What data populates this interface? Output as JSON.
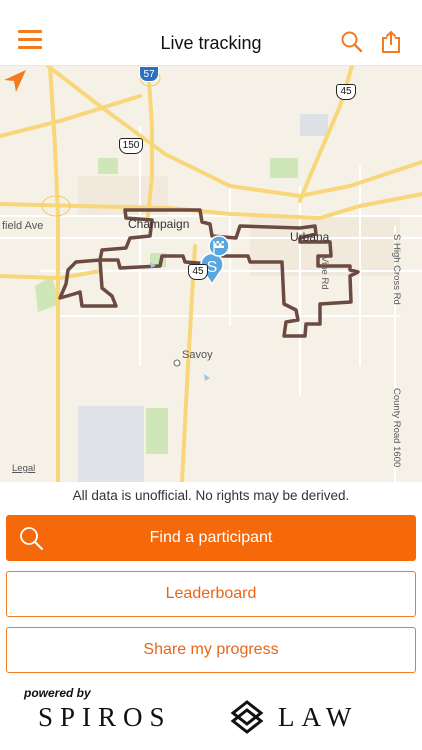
{
  "header": {
    "title": "Live tracking",
    "menu_icon": "hamburger-menu-icon",
    "search_icon": "search-icon",
    "share_icon": "share-icon"
  },
  "map": {
    "cities": {
      "champaign": "Champaign",
      "urbana": "Urbana",
      "savoy": "Savoy"
    },
    "roads": {
      "left_ave": "field Ave",
      "high_cross": "S High Cross Rd",
      "county_road": "County Road 1600",
      "vine": "Vine Rd"
    },
    "shields": {
      "i57": "57",
      "us150": "150",
      "us45_top": "45",
      "us45_mid": "45"
    },
    "legal": "Legal",
    "route_color": "#6b4a42",
    "marker_letter": "S",
    "marker_color": "#5aa7de"
  },
  "disclaimer": "All data is unofficial. No rights may be derived.",
  "buttons": {
    "find": "Find a participant",
    "leaderboard": "Leaderboard",
    "share": "Share my progress"
  },
  "sponsor": {
    "powered_by": "powered by",
    "name_part1": "SPIROS",
    "name_part2": "LAW"
  },
  "colors": {
    "accent": "#f5690b",
    "accent_text": "#e8661a"
  }
}
